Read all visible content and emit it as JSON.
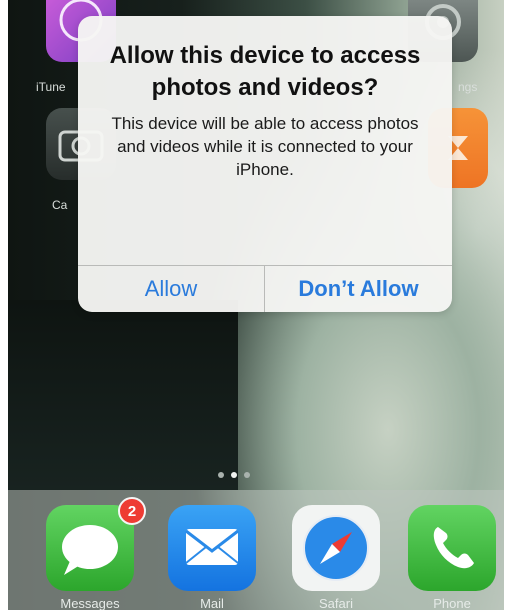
{
  "alert": {
    "title": "Allow this device to access photos and videos?",
    "message": "This device will be able to access photos and videos while it is connected to your iPhone.",
    "allow_label": "Allow",
    "deny_label": "Don’t Allow"
  },
  "home_screen": {
    "visible_labels": {
      "itunes": "iTune",
      "camera": "Ca",
      "settings": "ngs"
    },
    "page_dots": {
      "count": 3,
      "active_index": 1
    },
    "dock": [
      {
        "label": "Messages",
        "icon": "speech-bubble-icon",
        "badge": "2"
      },
      {
        "label": "Mail",
        "icon": "envelope-icon"
      },
      {
        "label": "Safari",
        "icon": "compass-icon"
      },
      {
        "label": "Phone",
        "icon": "phone-handset-icon"
      }
    ]
  },
  "colors": {
    "accent": "#2a7bdc",
    "badge": "#ee3b33",
    "messages_green": "#2ca62c",
    "mail_blue": "#1473e0"
  }
}
